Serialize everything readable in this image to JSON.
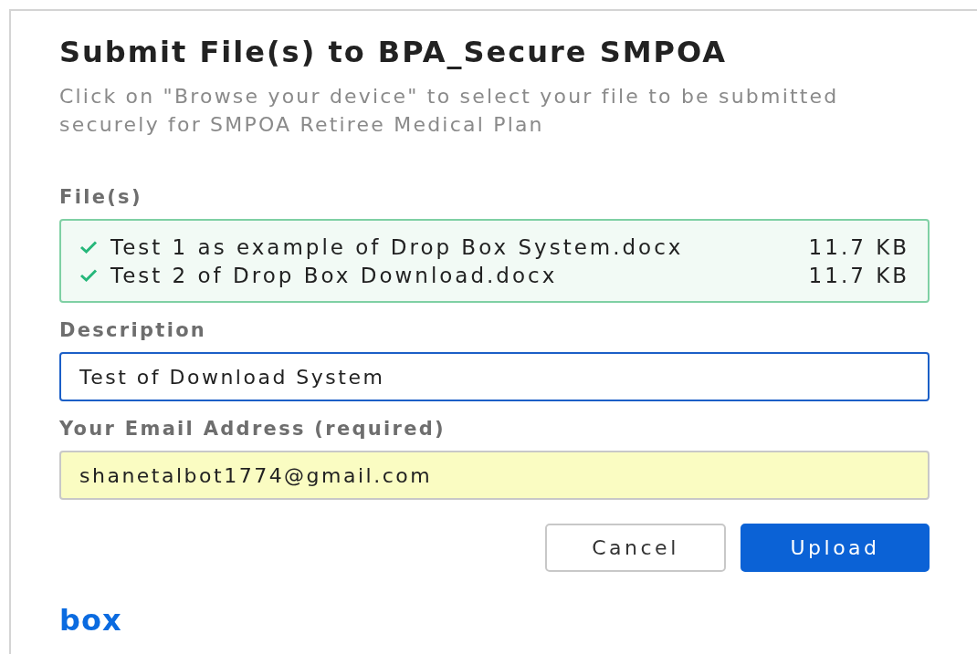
{
  "dialog": {
    "title": "Submit File(s) to BPA_Secure SMPOA",
    "description": "Click on \"Browse your device\" to select your file to be submitted securely for SMPOA Retiree Medical Plan"
  },
  "files_label": "File(s)",
  "files": [
    {
      "name": "Test 1 as example of Drop Box System.docx",
      "size": "11.7 KB",
      "done": true
    },
    {
      "name": "Test 2 of Drop Box Download.docx",
      "size": "11.7 KB",
      "done": true
    }
  ],
  "description_field": {
    "label": "Description",
    "value": "Test of Download System",
    "focused": true
  },
  "email_field": {
    "label": "Your Email Address (required)",
    "value": "shanetalbot1774@gmail.com",
    "autofilled": true
  },
  "buttons": [
    {
      "label": "Cancel",
      "kind": "secondary"
    },
    {
      "label": "Upload",
      "kind": "primary"
    }
  ],
  "logo": "box"
}
